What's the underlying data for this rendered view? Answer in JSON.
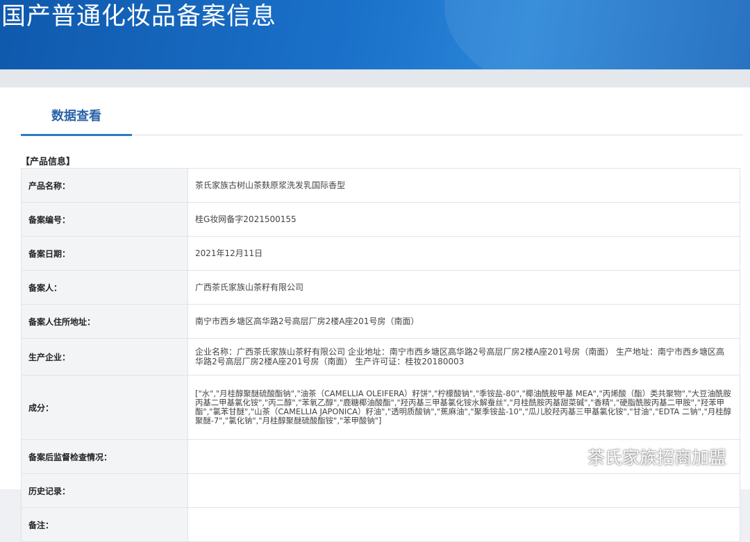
{
  "header": {
    "title": "国产普通化妆品备案信息"
  },
  "tabs": [
    {
      "label": "数据查看"
    }
  ],
  "section": {
    "title": "【产品信息】"
  },
  "rows": [
    {
      "key": "产品名称：",
      "value": "茶氏家族古树山茶麸原浆洗发乳国际香型"
    },
    {
      "key": "备案编号：",
      "value": "桂G妆网备字2021500155"
    },
    {
      "key": "备案日期：",
      "value": "2021年12月11日"
    },
    {
      "key": "备案人：",
      "value": "广西茶氏家族山茶籽有限公司"
    },
    {
      "key": "备案人住所地址：",
      "value": "南宁市西乡塘区高华路2号高层厂房2楼A座201号房（南面）"
    },
    {
      "key": "生产企业：",
      "value": "企业名称：广西茶氏家族山茶籽有限公司 企业地址：南宁市西乡塘区高华路2号高层厂房2楼A座201号房（南面） 生产地址：南宁市西乡塘区高华路2号高层厂房2楼A座201号房（南面） 生产许可证：桂妆20180003"
    },
    {
      "key": "成分：",
      "value": "[\"水\",\"月桂醇聚醚硫酸酯钠\",\"油茶（CAMELLIA OLEIFERA）籽饼\",\"柠檬酸钠\",\"季铵盐-80\",\"椰油酰胺甲基 MEA\",\"丙烯酸（酯）类共聚物\",\"大豆油酰胺丙基二甲基氯化铵\",\"丙二醇\",\"苯氧乙醇\",\"鹿糖椰油酸酯\",\"羟丙基三甲基氯化铵水解蚕丝\",\"月桂酰胺丙基甜菜碱\",\"香精\",\"硬脂酰胺丙基二甲胺\",\"羟苯甲酯\",\"氯苯甘醚\",\"山茶（CAMELLIA JAPONICA）籽油\",\"透明质酸钠\",\"蕉麻油\",\"聚季铵盐-10\",\"瓜儿胶羟丙基三甲基氯化铵\",\"甘油\",\"EDTA 二钠\",\"月桂醇聚醚-7\",\"氯化钠\",\"月桂醇聚醚硫酸酯铵\",\"苯甲酸钠\"]"
    },
    {
      "key": "备案后监督检查情况：",
      "value": ""
    },
    {
      "key": "历史记录：",
      "value": ""
    },
    {
      "key": "备注：",
      "value": ""
    }
  ],
  "watermark": {
    "text": "茶氏家族招商加盟",
    "icon": "wechat-icon"
  }
}
